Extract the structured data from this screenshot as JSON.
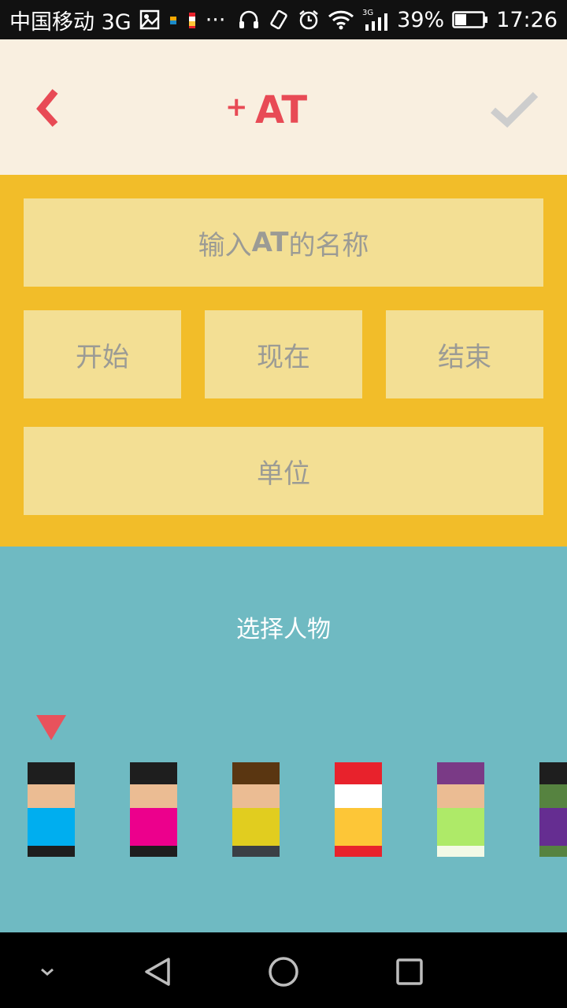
{
  "status_bar": {
    "carrier": "中国移动 3G",
    "network_label": "3G",
    "battery": "39%",
    "time": "17:26",
    "more": "···"
  },
  "header": {
    "back_icon": "chevron-left-icon",
    "logo_plus": "+",
    "logo_text": "AT",
    "confirm_icon": "checkmark-icon",
    "accent": "#e84a55"
  },
  "form": {
    "name_placeholder_prefix": "输入",
    "name_placeholder_bold": "AT",
    "name_placeholder_suffix": "的名称",
    "start_label": "开始",
    "now_label": "现在",
    "end_label": "结束",
    "unit_label": "单位"
  },
  "characters": {
    "title": "选择人物",
    "selected_index": 0,
    "items": [
      {
        "colors": [
          "#1e1e1e",
          "#ebbc93",
          "#00aeef",
          "#1e1e1e"
        ]
      },
      {
        "colors": [
          "#1e1e1e",
          "#ebbc93",
          "#ec008c",
          "#1e1e1e"
        ]
      },
      {
        "colors": [
          "#5a3611",
          "#ebbc93",
          "#e1cd1f",
          "#3b3f45"
        ]
      },
      {
        "colors": [
          "#e8222c",
          "#ffffff",
          "#fdc637",
          "#e8222c"
        ]
      },
      {
        "colors": [
          "#7a3a86",
          "#ebbc93",
          "#aeea68",
          "#f3f9e6"
        ]
      },
      {
        "colors": [
          "#1e1e1e",
          "#568340",
          "#652d91",
          "#568340"
        ]
      }
    ]
  },
  "nav": {
    "down": "chevron-down-icon",
    "back": "triangle-back-icon",
    "home": "circle-home-icon",
    "recents": "square-recents-icon"
  }
}
